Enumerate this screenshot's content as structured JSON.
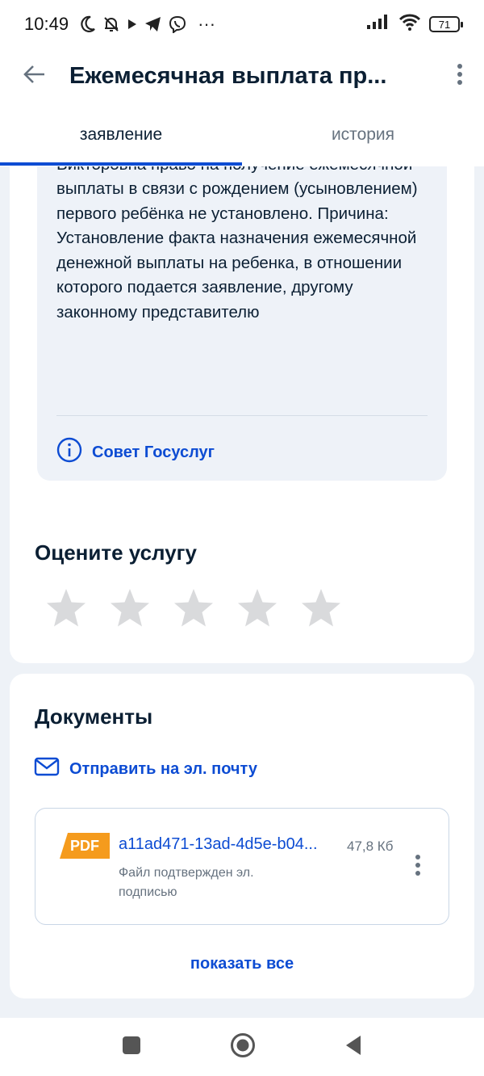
{
  "status_bar": {
    "time": "10:49",
    "battery": "71",
    "icons": [
      "moon-icon",
      "bell-off-icon",
      "play-icon",
      "telegram-icon",
      "viber-icon",
      "more-dots-icon",
      "signal-icon",
      "wifi-icon",
      "battery-icon"
    ],
    "more": "···"
  },
  "header": {
    "title": "Ежемесячная выплата пр..."
  },
  "tabs": [
    {
      "label": "заявление",
      "active": true
    },
    {
      "label": "история",
      "active": false
    }
  ],
  "decision": {
    "text": "В отношении ребенка Косцова Елизавета Викторовна право на получение ежемесячной выплаты в связи с рождением (усыновлением) первого ребёнка не установлено. Причина: Установление факта назначения ежемесячной денежной выплаты на ребенка, в отношении которого подается заявление, другому законному представителю",
    "advice_label": "Совет Госуслуг"
  },
  "rating": {
    "title": "Оцените услугу",
    "stars_total": 5,
    "stars_selected": 0
  },
  "documents": {
    "title": "Документы",
    "email_label": "Отправить на эл. почту",
    "files": [
      {
        "type": "PDF",
        "name": "a11ad471-13ad-4d5e-b04...",
        "size": "47,8 Кб",
        "note": "Файл подтвержден эл. подписью"
      }
    ],
    "show_all_label": "показать все"
  },
  "colors": {
    "accent": "#0d4cd3",
    "pdf_badge": "#f59b1d",
    "star_empty": "#d9dadc",
    "info_bg": "#eef2f8"
  }
}
